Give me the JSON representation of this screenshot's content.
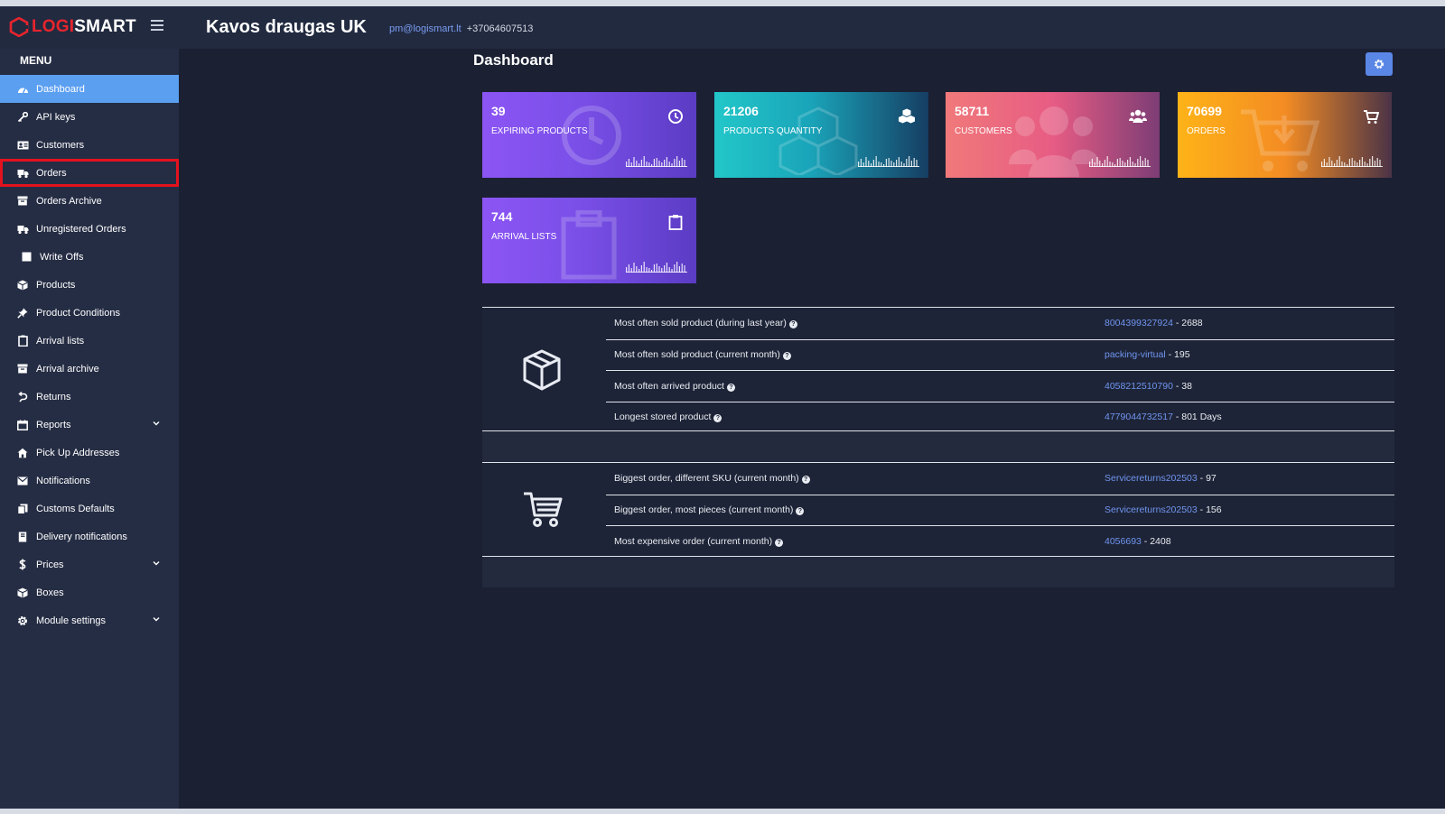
{
  "header": {
    "logo": {
      "part1": "LOGI",
      "part2": "SMART"
    },
    "client_name": "Kavos draugas UK",
    "email": "pm@logismart.lt",
    "phone": "+37064607513"
  },
  "sidebar": {
    "menu_title": "MENU",
    "items": [
      {
        "label": "Dashboard",
        "icon": "dashboard-icon"
      },
      {
        "label": "API keys",
        "icon": "key-icon"
      },
      {
        "label": "Customers",
        "icon": "id-card-icon"
      },
      {
        "label": "Orders",
        "icon": "truck-icon"
      },
      {
        "label": "Orders Archive",
        "icon": "archive-icon"
      },
      {
        "label": "Unregistered Orders",
        "icon": "truck-icon"
      },
      {
        "label": "Write Offs",
        "icon": "square-icon"
      },
      {
        "label": "Products",
        "icon": "cube-icon"
      },
      {
        "label": "Product Conditions",
        "icon": "pin-icon"
      },
      {
        "label": "Arrival lists",
        "icon": "clipboard-icon"
      },
      {
        "label": "Arrival archive",
        "icon": "archive-icon"
      },
      {
        "label": "Returns",
        "icon": "return-icon"
      },
      {
        "label": "Reports",
        "icon": "calendar-icon"
      },
      {
        "label": "Pick Up Addresses",
        "icon": "home-icon"
      },
      {
        "label": "Notifications",
        "icon": "envelope-icon"
      },
      {
        "label": "Customs Defaults",
        "icon": "copy-icon"
      },
      {
        "label": "Delivery notifications",
        "icon": "book-icon"
      },
      {
        "label": "Prices",
        "icon": "dollar-icon"
      },
      {
        "label": "Boxes",
        "icon": "cube-icon"
      },
      {
        "label": "Module settings",
        "icon": "gear-icon"
      }
    ],
    "active": "Dashboard",
    "highlighted": "Orders"
  },
  "main": {
    "title": "Dashboard",
    "cards": [
      {
        "value": "39",
        "label": "EXPIRING PRODUCTS",
        "icon": "clock-icon"
      },
      {
        "value": "21206",
        "label": "PRODUCTS QUANTITY",
        "icon": "cubes-icon"
      },
      {
        "value": "58711",
        "label": "CUSTOMERS",
        "icon": "users-icon"
      },
      {
        "value": "70699",
        "label": "ORDERS",
        "icon": "cart-icon"
      },
      {
        "value": "744",
        "label": "ARRIVAL LISTS",
        "icon": "clipboard-icon"
      }
    ],
    "product_stats": [
      {
        "question": "Most often sold product (during last year)",
        "link": "8004399327924",
        "suffix": " - 2688"
      },
      {
        "question": "Most often sold product (current month)",
        "link": "packing-virtual",
        "suffix": " - 195"
      },
      {
        "question": "Most often arrived product",
        "link": "4058212510790",
        "suffix": " - 38"
      },
      {
        "question": "Longest stored product",
        "link": "4779044732517",
        "suffix": " - 801 Days"
      }
    ],
    "order_stats": [
      {
        "question": "Biggest order, different SKU (current month)",
        "link": "Servicereturns202503",
        "suffix": " - 97"
      },
      {
        "question": "Biggest order, most pieces (current month)",
        "link": "Servicereturns202503",
        "suffix": " - 156"
      },
      {
        "question": "Most expensive order (current month)",
        "link": "4056693",
        "suffix": " - 2408"
      }
    ]
  },
  "colors": {
    "accent": "#5b9ff0",
    "highlight": "#e4121e",
    "link": "#6f95f0"
  }
}
